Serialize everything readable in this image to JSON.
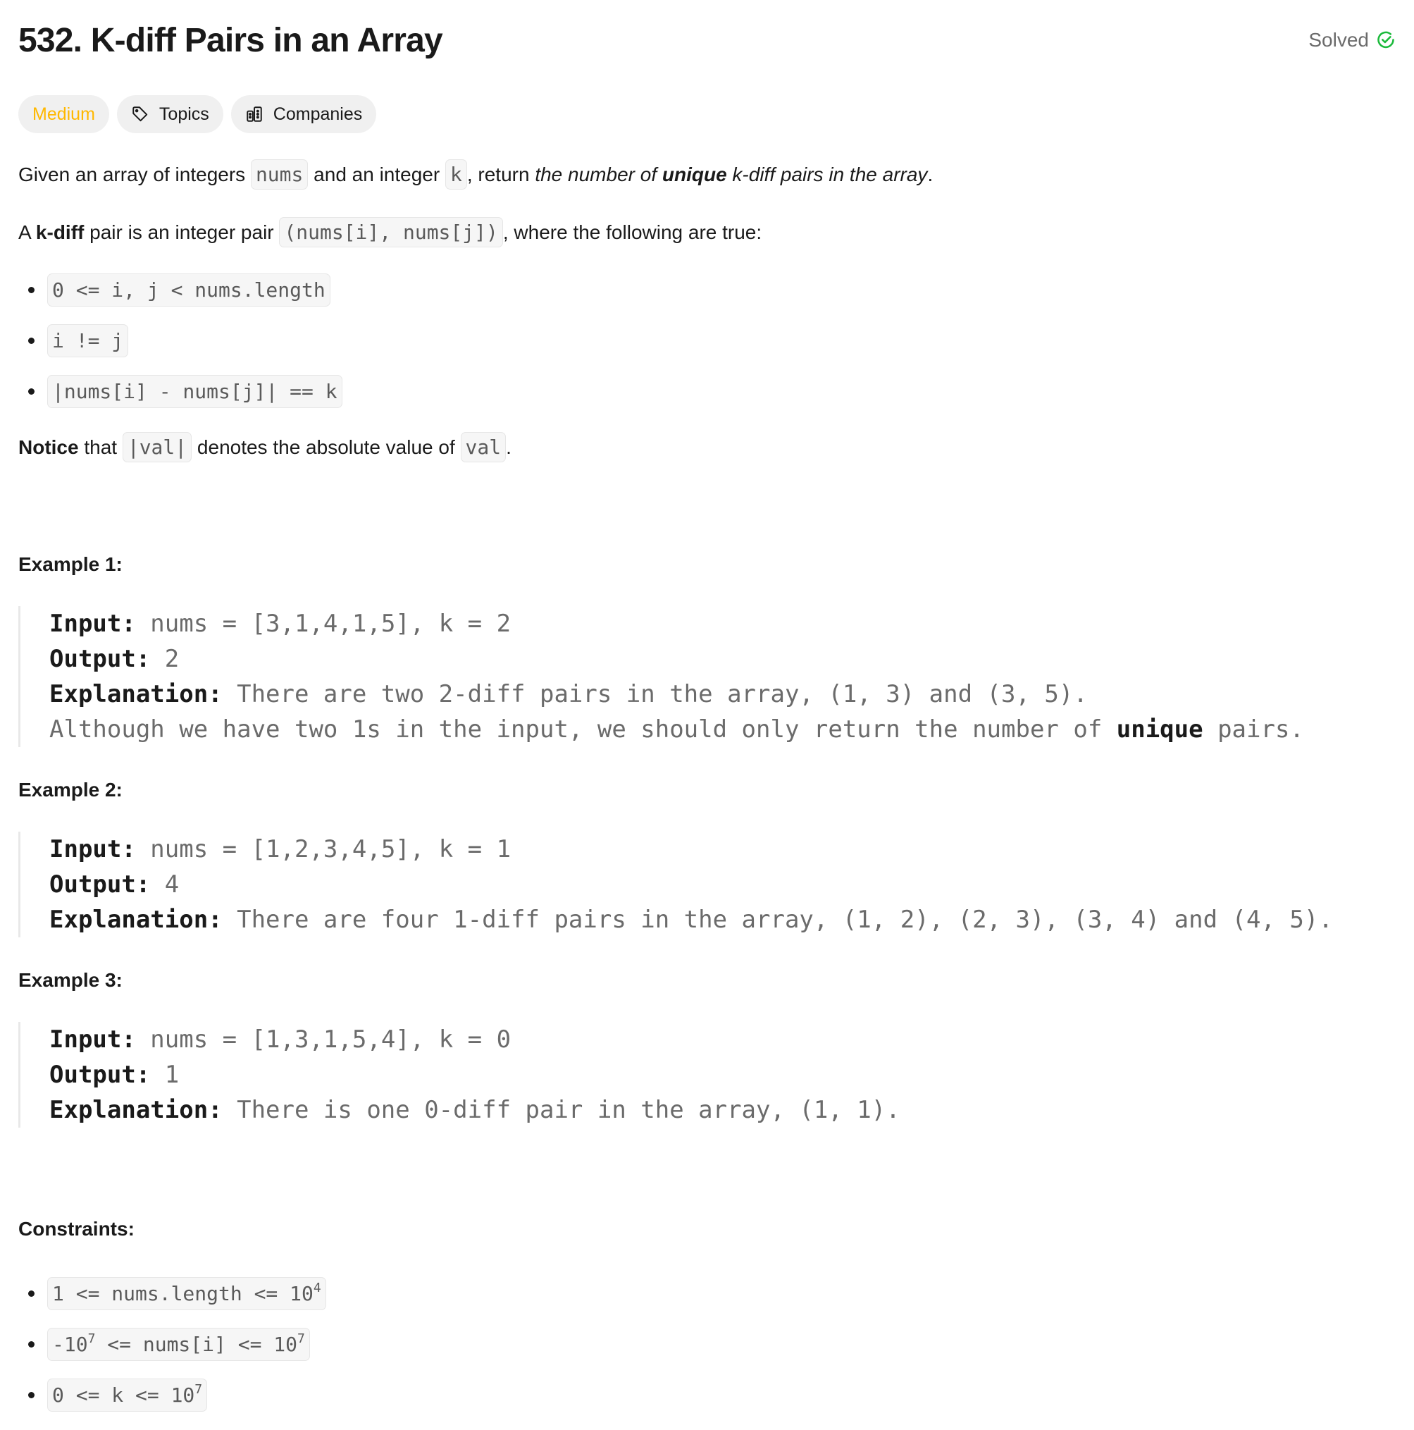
{
  "problem": {
    "title": "532. K-diff Pairs in an Array",
    "status_label": "Solved",
    "status_color": "#1cba3c"
  },
  "tags": {
    "difficulty": "Medium",
    "difficulty_color": "#ffb800",
    "topics_label": "Topics",
    "companies_label": "Companies"
  },
  "description": {
    "p1": {
      "t1": "Given an array of integers ",
      "c1": "nums",
      "t2": " and an integer ",
      "c2": "k",
      "t3": ", return ",
      "i1": "the number of ",
      "ib": "unique",
      "i2": " k-diff pairs in the array",
      "t4": "."
    },
    "p2": {
      "t1": "A ",
      "b1": "k-diff",
      "t2": " pair is an integer pair ",
      "c1": "(nums[i], nums[j])",
      "t3": ", where the following are true:"
    },
    "conditions": [
      "0 <= i, j < nums.length",
      "i != j",
      "|nums[i] - nums[j]| == k"
    ],
    "notice": {
      "b1": "Notice",
      "t1": " that ",
      "c1": "|val|",
      "t2": " denotes the absolute value of ",
      "c2": "val",
      "t3": "."
    }
  },
  "examples": [
    {
      "heading": "Example 1:",
      "input_label": "Input:",
      "input": " nums = [3,1,4,1,5], k = 2",
      "output_label": "Output:",
      "output": " 2",
      "explanation_label": "Explanation:",
      "explanation": " There are two 2-diff pairs in the array, (1, 3) and (3, 5).",
      "extra_pre": "Although we have two 1s in the input, we should only return the number of ",
      "extra_bold": "unique",
      "extra_post": " pairs."
    },
    {
      "heading": "Example 2:",
      "input_label": "Input:",
      "input": " nums = [1,2,3,4,5], k = 1",
      "output_label": "Output:",
      "output": " 4",
      "explanation_label": "Explanation:",
      "explanation": " There are four 1-diff pairs in the array, (1, 2), (2, 3), (3, 4) and (4, 5)."
    },
    {
      "heading": "Example 3:",
      "input_label": "Input:",
      "input": " nums = [1,3,1,5,4], k = 0",
      "output_label": "Output:",
      "output": " 1",
      "explanation_label": "Explanation:",
      "explanation": " There is one 0-diff pair in the array, (1, 1)."
    }
  ],
  "constraints": {
    "heading": "Constraints:",
    "items": [
      {
        "pre": "1 <= nums.length <= 10",
        "sup": "4"
      },
      {
        "pre": "-10",
        "sup1": "7",
        "mid": " <= nums[i] <= 10",
        "sup2": "7"
      },
      {
        "pre": "0 <= k <= 10",
        "sup": "7"
      }
    ]
  }
}
